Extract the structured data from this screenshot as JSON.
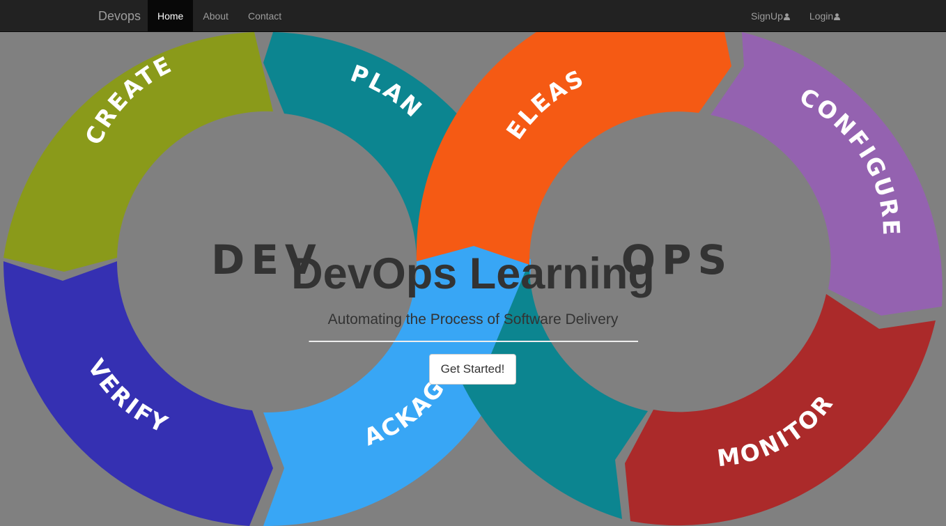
{
  "navbar": {
    "brand": "Devops",
    "links": [
      {
        "label": "Home",
        "active": true
      },
      {
        "label": "About",
        "active": false
      },
      {
        "label": "Contact",
        "active": false
      }
    ],
    "auth": [
      {
        "label": "SignUp",
        "icon": "user-icon"
      },
      {
        "label": "Login",
        "icon": "user-icon"
      }
    ]
  },
  "diagram": {
    "loops": [
      {
        "label": "DEV"
      },
      {
        "label": "OPS"
      }
    ],
    "stages": [
      {
        "label": "CREATE",
        "color": "#8a9a1a"
      },
      {
        "label": "PLAN",
        "color": "#0c8590"
      },
      {
        "label": "VERIFY",
        "color": "#3530b2"
      },
      {
        "label": "PACKAGE",
        "color": "#38a6f5"
      },
      {
        "label": "RELEASE",
        "color": "#f55a14"
      },
      {
        "label": "CONFIGURE",
        "color": "#9462b0"
      },
      {
        "label": "MONITOR",
        "color": "#ab2a2a"
      }
    ]
  },
  "hero": {
    "title": "DevOps Learning",
    "subtitle": "Automating the Process of Software Delivery",
    "cta_label": "Get Started!"
  },
  "colors": {
    "background": "#808080",
    "navbar": "#222222",
    "active_tab": "#080808",
    "hero_text": "#333333"
  }
}
